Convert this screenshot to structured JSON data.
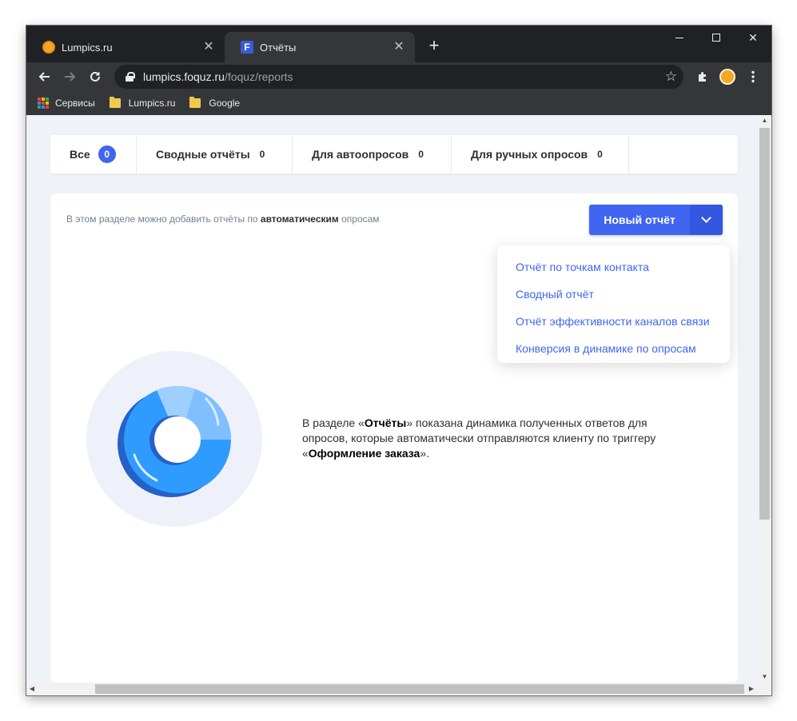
{
  "browser": {
    "tabs": [
      {
        "title": "Lumpics.ru",
        "active": false,
        "favicon": "orange-circle-icon"
      },
      {
        "title": "Отчёты",
        "active": true,
        "favicon": "foquz-f-icon"
      }
    ],
    "url": {
      "host": "lumpics.foquz.ru",
      "path": "/foquz/reports"
    },
    "bookmarks": [
      {
        "label": "Сервисы",
        "icon": "apps-grid-icon"
      },
      {
        "label": "Lumpics.ru",
        "icon": "folder-icon"
      },
      {
        "label": "Google",
        "icon": "folder-icon"
      }
    ]
  },
  "filter_tabs": [
    {
      "label": "Все",
      "count": "0",
      "active": true
    },
    {
      "label": "Сводные отчёты",
      "count": "0",
      "active": false
    },
    {
      "label": "Для автоопросов",
      "count": "0",
      "active": false
    },
    {
      "label": "Для ручных опросов",
      "count": "0",
      "active": false
    }
  ],
  "main": {
    "hint_prefix": "В этом разделе можно добавить отчёты по ",
    "hint_bold": "автоматическим",
    "hint_suffix": " опросам",
    "new_report_label": "Новый отчёт",
    "dropdown_items": [
      "Отчёт по точкам контакта",
      "Сводный отчёт",
      "Отчёт эффективности каналов связи",
      "Конверсия в динамике по опросам"
    ],
    "description": {
      "p1": "В разделе «",
      "b1": "Отчёты",
      "p2": "» показана динамика полученных ответов для опросов, которые автоматически отправляются клиенту по триггеру «",
      "b2": "Оформление заказа",
      "p3": "»."
    }
  },
  "colors": {
    "accent": "#3f65f1",
    "page_bg": "#eff2f7",
    "chrome_dark": "#202124",
    "chrome_toolbar": "#35363a"
  }
}
